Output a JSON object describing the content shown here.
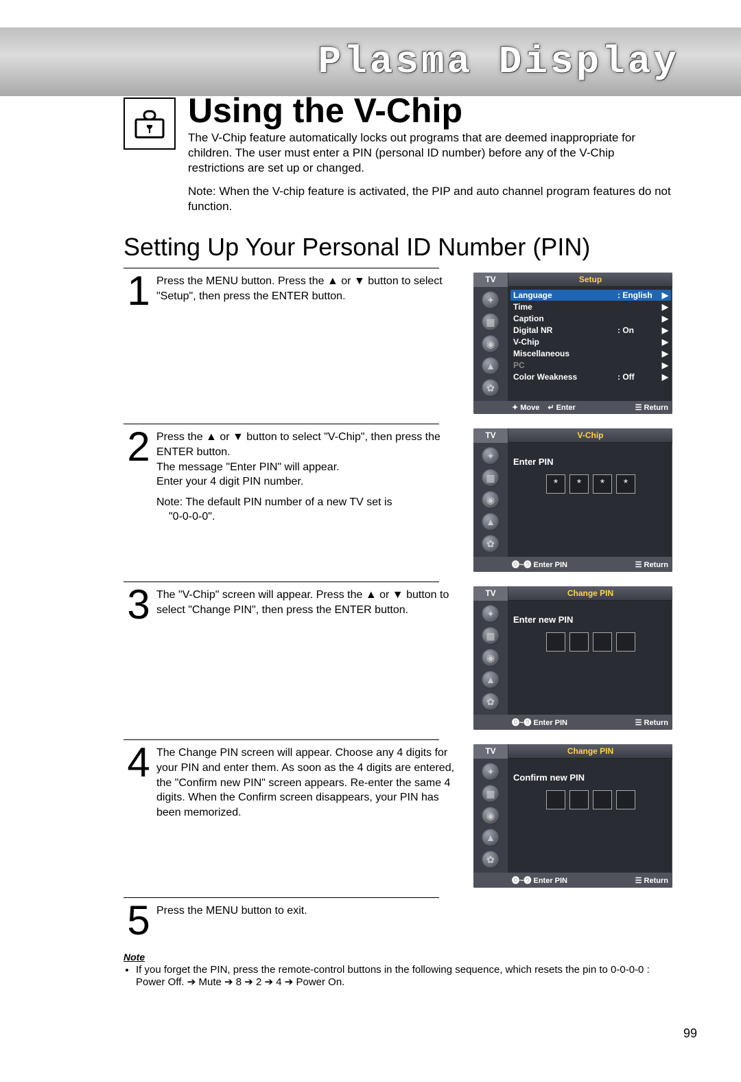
{
  "banner": {
    "title": "Plasma Display"
  },
  "header": {
    "title": "Using the V-Chip",
    "intro": "The V-Chip feature automatically locks out programs that are deemed inappropriate for children. The user must enter a PIN (personal ID number) before any of the V-Chip restrictions are set up or changed.",
    "note": "Note: When the V-chip feature is activated, the PIP and auto channel program features do not function."
  },
  "section_heading": "Setting Up Your Personal ID Number (PIN)",
  "steps": [
    {
      "num": "1",
      "text": "Press the MENU button. Press the ▲ or ▼ button to select \"Setup\", then press the ENTER button.",
      "osd": {
        "tab_left": "TV",
        "tab_right": "Setup",
        "rows": [
          {
            "label": "Language",
            "val": ":  English",
            "arrow": "▶",
            "selected": true
          },
          {
            "label": "Time",
            "val": "",
            "arrow": "▶"
          },
          {
            "label": "Caption",
            "val": "",
            "arrow": "▶"
          },
          {
            "label": "Digital NR",
            "val": ":  On",
            "arrow": "▶"
          },
          {
            "label": "V-Chip",
            "val": "",
            "arrow": "▶"
          },
          {
            "label": "Miscellaneous",
            "val": "",
            "arrow": "▶"
          },
          {
            "label": "PC",
            "val": "",
            "arrow": "▶",
            "dim": true
          },
          {
            "label": "Color Weakness",
            "val": ":  Off",
            "arrow": "▶"
          }
        ],
        "footer": {
          "left": "✦ Move",
          "mid": "↵ Enter",
          "right": "☰ Return"
        }
      }
    },
    {
      "num": "2",
      "text1": "Press the ▲ or ▼ button to select \"V-Chip\", then press the ENTER button.",
      "text2": "The message \"Enter PIN\" will appear.",
      "text3": "Enter your 4 digit PIN number.",
      "text4": "Note: The default PIN number of a new TV set is",
      "text4b": "\"0-0-0-0\".",
      "osd": {
        "tab_left": "TV",
        "tab_right": "V-Chip",
        "center": "Enter PIN",
        "pin_filled": true,
        "footer": {
          "left": "⓿~❾  Enter PIN",
          "right": "☰ Return"
        }
      }
    },
    {
      "num": "3",
      "text": "The \"V-Chip\" screen will appear. Press the ▲ or ▼ button to select \"Change PIN\", then press the ENTER button.",
      "osd": {
        "tab_left": "TV",
        "tab_right": "Change PIN",
        "center": "Enter new PIN",
        "pin_filled": false,
        "footer": {
          "left": "⓿~❾  Enter PIN",
          "right": "☰ Return"
        }
      }
    },
    {
      "num": "4",
      "text": "The Change PIN screen will appear. Choose any 4 digits for your PIN and enter them. As soon as the 4 digits are entered, the \"Confirm new PIN\" screen appears. Re-enter the same 4 digits. When the Confirm screen disappears, your PIN has been memorized.",
      "osd": {
        "tab_left": "TV",
        "tab_right": "Change PIN",
        "center": "Confirm new PIN",
        "pin_filled": false,
        "footer": {
          "left": "⓿~❾  Enter PIN",
          "right": "☰ Return"
        }
      }
    },
    {
      "num": "5",
      "text": "Press the MENU button to exit."
    }
  ],
  "footnote": {
    "title": "Note",
    "text": "If you forget the PIN, press the remote-control buttons in the following sequence, which resets the pin to  0-0-0-0 : Power Off. ➔ Mute ➔ 8 ➔ 2 ➔ 4 ➔ Power On."
  },
  "page_number": "99"
}
